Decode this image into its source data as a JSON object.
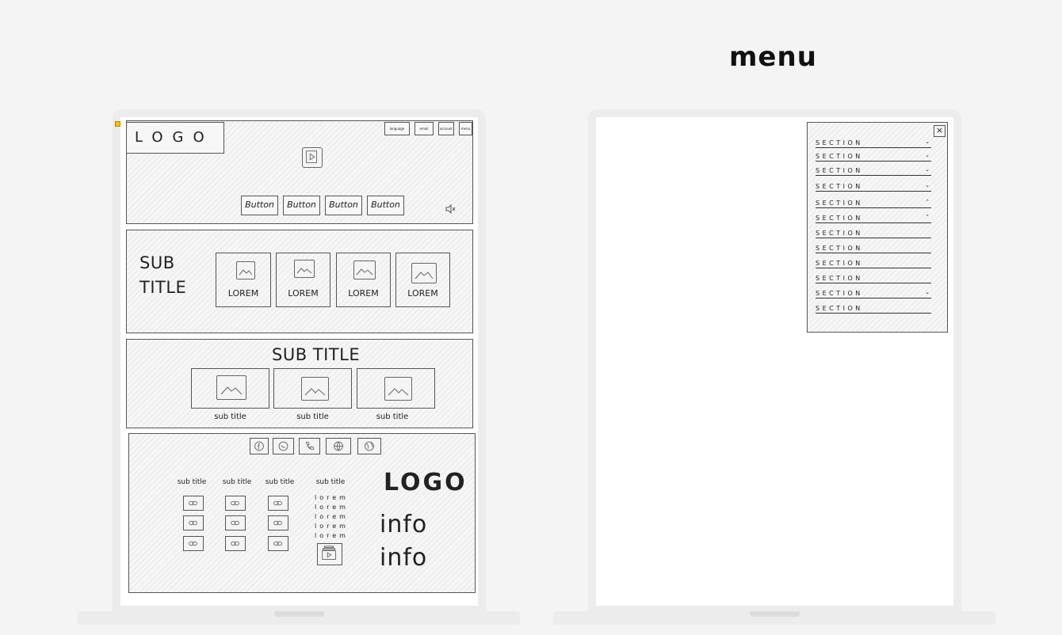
{
  "menu_heading": "menu",
  "header": {
    "logo": "LOGO",
    "top_buttons": [
      "language",
      "email",
      "account",
      "menu"
    ],
    "buttons": [
      "Button",
      "Button",
      "Button",
      "Button"
    ]
  },
  "section1": {
    "subtitle": "SUB TITLE",
    "cards": [
      "LOREM",
      "LOREM",
      "LOREM",
      "LOREM"
    ]
  },
  "section2": {
    "subtitle": "SUB TITLE",
    "captions": [
      "sub title",
      "sub title",
      "sub title"
    ]
  },
  "footer": {
    "social_icons": [
      "facebook-icon",
      "whatsapp-icon",
      "phone-icon",
      "globe-icon",
      "world-icon"
    ],
    "columns": [
      "sub title",
      "sub title",
      "sub title",
      "sub title"
    ],
    "lorem": [
      "lorem",
      "lorem",
      "lorem",
      "lorem",
      "lorem"
    ],
    "logo": "LOGO",
    "info": [
      "info",
      "info"
    ]
  },
  "menu": {
    "items": [
      {
        "label": "SECTION",
        "chevron": "⌄"
      },
      {
        "label": "SECTION",
        "chevron": "⌄"
      },
      {
        "label": "SECTION",
        "chevron": "⌄"
      },
      {
        "label": "SECTION",
        "chevron": "⌄"
      },
      {
        "label": "SECTION",
        "chevron": "⌃"
      },
      {
        "label": "SECTION",
        "chevron": "⌃"
      },
      {
        "label": "SECTION",
        "chevron": ""
      },
      {
        "label": "SECTION",
        "chevron": ""
      },
      {
        "label": "SECTION",
        "chevron": ""
      },
      {
        "label": "SECTION",
        "chevron": ""
      },
      {
        "label": "SECTION",
        "chevron": "⌄"
      },
      {
        "label": "SECTION",
        "chevron": ""
      }
    ],
    "close": "×"
  }
}
